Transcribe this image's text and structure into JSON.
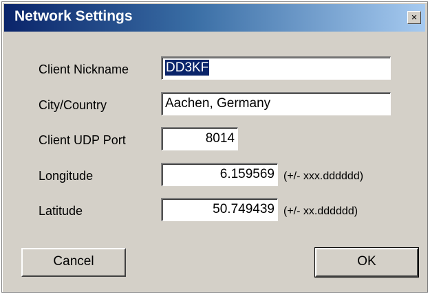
{
  "window": {
    "title": "Network Settings",
    "close_glyph": "×",
    "close_icon": "close-icon"
  },
  "fields": {
    "nickname": {
      "label": "Client Nickname",
      "value": "DD3KF",
      "selected": true
    },
    "city": {
      "label": "City/Country",
      "value": "Aachen, Germany"
    },
    "udp_port": {
      "label": "Client UDP Port",
      "value": "8014"
    },
    "longitude": {
      "label": "Longitude",
      "value": "6.159569",
      "hint": "(+/- xxx.dddddd)"
    },
    "latitude": {
      "label": "Latitude",
      "value": "50.749439",
      "hint": "(+/- xx.dddddd)"
    }
  },
  "buttons": {
    "cancel": "Cancel",
    "ok": "OK"
  },
  "colors": {
    "dialog_bg": "#d4d0c8",
    "title_gradient_start": "#0a246a",
    "title_gradient_end": "#a6caf0",
    "selection": "#0a246a"
  }
}
